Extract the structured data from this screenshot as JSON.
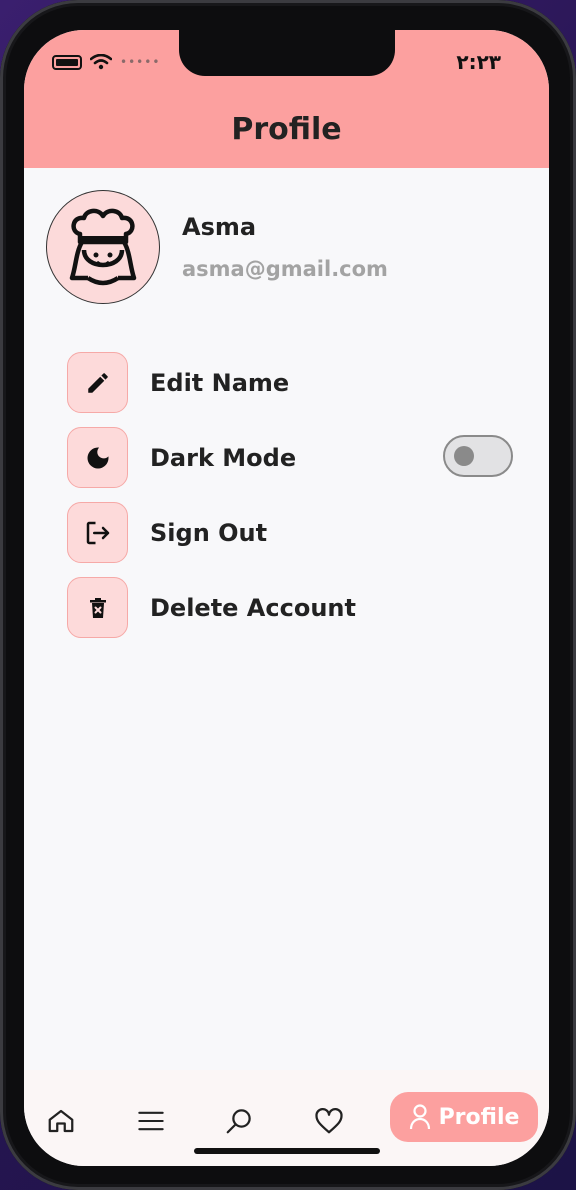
{
  "status_bar": {
    "time": "٢:٢٣",
    "signal_dots": "•••••"
  },
  "header": {
    "title": "Profile"
  },
  "user": {
    "name": "Asma",
    "email": "asma@gmail.com",
    "avatar_icon": "chef-avatar-icon"
  },
  "menu": {
    "items": [
      {
        "label": "Edit Name",
        "icon": "pencil-icon"
      },
      {
        "label": "Dark Mode",
        "icon": "moon-icon",
        "toggle": false
      },
      {
        "label": "Sign Out",
        "icon": "sign-out-icon"
      },
      {
        "label": "Delete Account",
        "icon": "trash-icon"
      }
    ]
  },
  "bottom_nav": {
    "items": [
      {
        "icon": "home-icon"
      },
      {
        "icon": "menu-icon"
      },
      {
        "icon": "search-icon"
      },
      {
        "icon": "heart-icon"
      }
    ],
    "active": {
      "icon": "user-icon",
      "label": "Profile"
    }
  },
  "colors": {
    "accent": "#fca09f",
    "icon_bg": "#fddada",
    "background": "#f8f8fa"
  }
}
